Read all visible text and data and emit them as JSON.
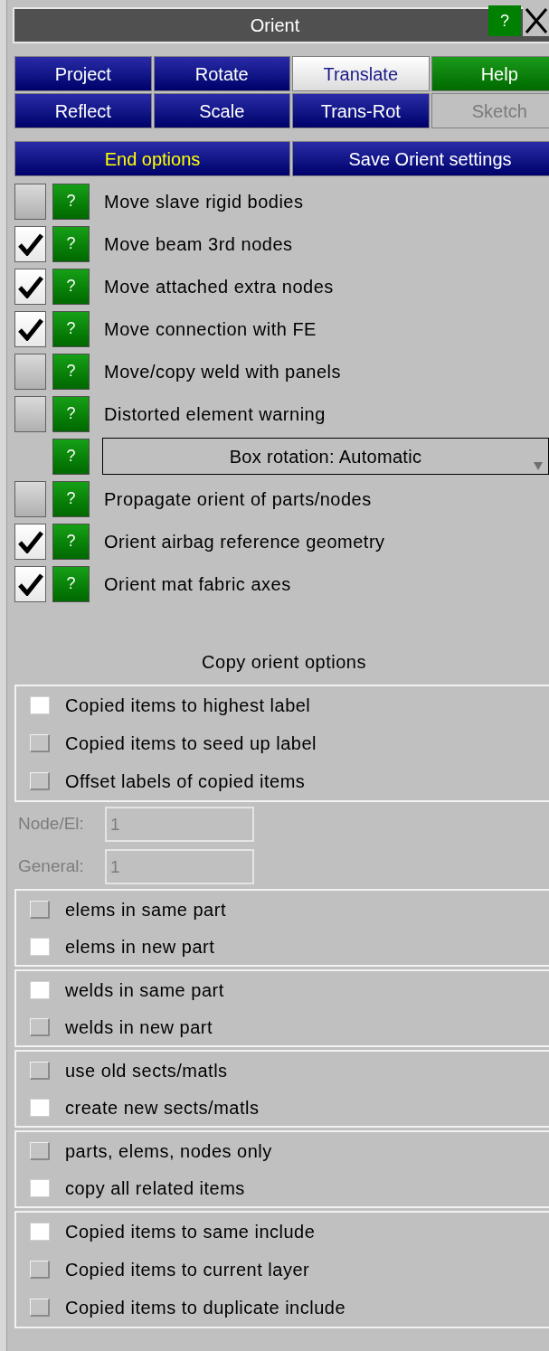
{
  "window": {
    "title": "Orient",
    "help": "?"
  },
  "mode_buttons": [
    {
      "label": "Project",
      "kind": "mode",
      "selected": false,
      "disabled": false
    },
    {
      "label": "Rotate",
      "kind": "mode",
      "selected": false,
      "disabled": false
    },
    {
      "label": "Translate",
      "kind": "mode",
      "selected": true,
      "disabled": false
    },
    {
      "label": "Help",
      "kind": "help",
      "selected": false,
      "disabled": false
    },
    {
      "label": "Reflect",
      "kind": "mode",
      "selected": false,
      "disabled": false
    },
    {
      "label": "Scale",
      "kind": "mode",
      "selected": false,
      "disabled": false
    },
    {
      "label": "Trans-Rot",
      "kind": "mode",
      "selected": false,
      "disabled": false
    },
    {
      "label": "Sketch",
      "kind": "mode",
      "selected": false,
      "disabled": true
    }
  ],
  "action_buttons": [
    {
      "label": "End options",
      "highlight": true
    },
    {
      "label": "Save Orient settings",
      "highlight": false
    }
  ],
  "options": [
    {
      "kind": "checkbox",
      "label": "Move slave rigid bodies",
      "checked": false,
      "help": "?"
    },
    {
      "kind": "checkbox",
      "label": "Move beam 3rd nodes",
      "checked": true,
      "help": "?"
    },
    {
      "kind": "checkbox",
      "label": "Move attached extra nodes",
      "checked": true,
      "help": "?"
    },
    {
      "kind": "checkbox",
      "label": "Move connection with FE",
      "checked": true,
      "help": "?"
    },
    {
      "kind": "checkbox",
      "label": "Move/copy weld with panels",
      "checked": false,
      "help": "?"
    },
    {
      "kind": "checkbox",
      "label": "Distorted element warning",
      "checked": false,
      "help": "?"
    },
    {
      "kind": "dropdown",
      "label": "Box rotation: Automatic",
      "help": "?"
    },
    {
      "kind": "checkbox",
      "label": "Propagate orient of parts/nodes",
      "checked": false,
      "help": "?"
    },
    {
      "kind": "checkbox",
      "label": "Orient airbag reference geometry",
      "checked": true,
      "help": "?"
    },
    {
      "kind": "checkbox",
      "label": "Orient mat fabric axes",
      "checked": true,
      "help": "?"
    }
  ],
  "copy_options": {
    "heading": "Copy orient options",
    "sections": [
      {
        "kind": "group",
        "items": [
          {
            "label": "Copied items to highest label",
            "selected": true
          },
          {
            "label": "Copied items to seed up label",
            "selected": false
          },
          {
            "label": "Offset labels of copied items",
            "selected": false
          }
        ]
      },
      {
        "kind": "fields",
        "fields": [
          {
            "label": "Node/El:",
            "value": "1"
          },
          {
            "label": "General:",
            "value": "1"
          }
        ]
      },
      {
        "kind": "group",
        "items": [
          {
            "label": "elems in same part",
            "selected": false
          },
          {
            "label": "elems in new part",
            "selected": true
          }
        ]
      },
      {
        "kind": "group",
        "items": [
          {
            "label": "welds in same part",
            "selected": true
          },
          {
            "label": "welds in new part",
            "selected": false
          }
        ]
      },
      {
        "kind": "group",
        "items": [
          {
            "label": "use old sects/matls",
            "selected": false
          },
          {
            "label": "create new sects/matls",
            "selected": true
          }
        ]
      },
      {
        "kind": "group",
        "items": [
          {
            "label": "parts, elems, nodes only",
            "selected": false
          },
          {
            "label": "copy all related items",
            "selected": true
          }
        ]
      },
      {
        "kind": "group",
        "items": [
          {
            "label": "Copied items to same include",
            "selected": true
          },
          {
            "label": "Copied items to current layer",
            "selected": false
          },
          {
            "label": "Copied items to duplicate include",
            "selected": false
          }
        ]
      }
    ]
  }
}
